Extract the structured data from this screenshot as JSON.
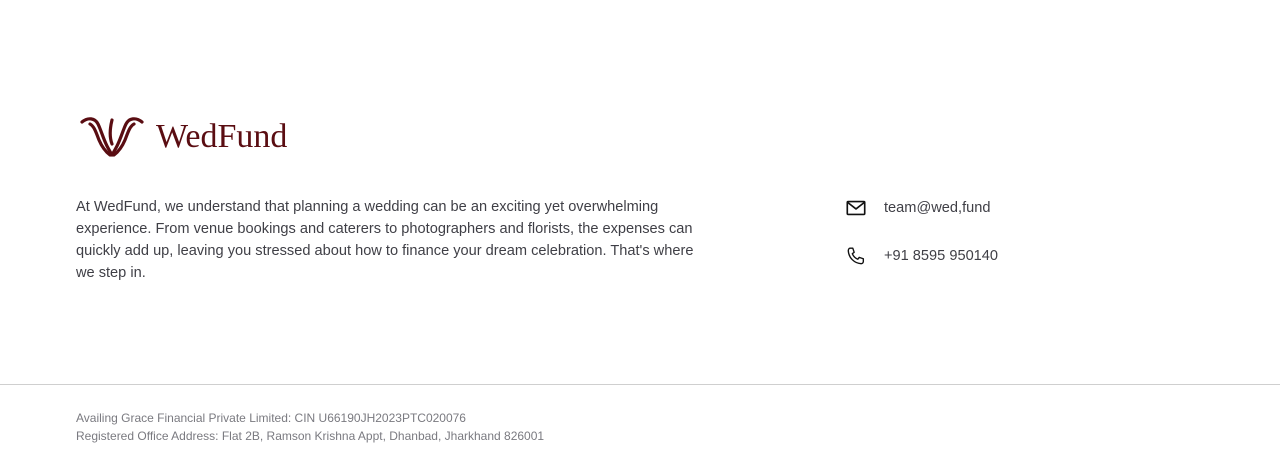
{
  "brand": {
    "name": "WedFund",
    "color": "#5a0d12",
    "logo_icon": "wedfund-logo-icon"
  },
  "about": {
    "text": "At WedFund, we understand that planning a wedding can be an exciting yet overwhelming experience. From venue bookings and caterers to photographers and florists, the expenses can quickly add up, leaving you stressed about how to finance your dream celebration. That's where we step in."
  },
  "contact": {
    "email": "team@wed,fund",
    "email_icon": "mail-icon",
    "phone": "+91 8595 950140",
    "phone_icon": "phone-icon"
  },
  "legal": {
    "company": "Availing Grace Financial Private Limited: CIN U66190JH2023PTC020076",
    "address": "Registered Office Address: Flat 2B, Ramson Krishna Appt, Dhanbad, Jharkhand 826001"
  }
}
